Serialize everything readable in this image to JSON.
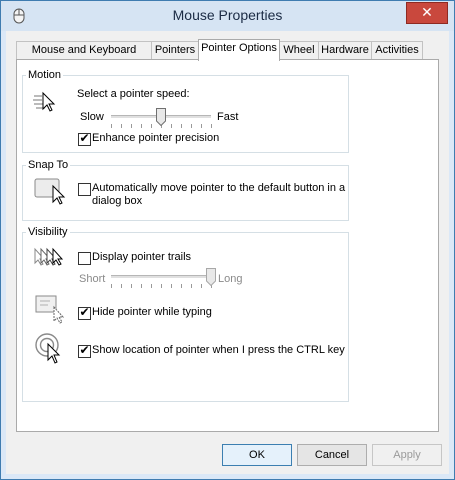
{
  "window": {
    "title": "Mouse Properties",
    "close_glyph": "✕"
  },
  "tabs": [
    {
      "label": "Mouse and Keyboard Center",
      "active": false
    },
    {
      "label": "Pointers",
      "active": false
    },
    {
      "label": "Pointer Options",
      "active": true
    },
    {
      "label": "Wheel",
      "active": false
    },
    {
      "label": "Hardware",
      "active": false
    },
    {
      "label": "Activities",
      "active": false
    }
  ],
  "motion": {
    "group_label": "Motion",
    "prompt": "Select a pointer speed:",
    "slow_label": "Slow",
    "fast_label": "Fast",
    "speed_level": 0.5,
    "enhance_label": "Enhance pointer precision",
    "enhance_checked": true
  },
  "snap_to": {
    "group_label": "Snap To",
    "line1": "Automatically move pointer to the default button in a",
    "line2": "dialog box",
    "checked": false
  },
  "visibility": {
    "group_label": "Visibility",
    "trails_label": "Display pointer trails",
    "trails_checked": false,
    "short_label": "Short",
    "long_label": "Long",
    "trail_level": 1.0,
    "hide_label": "Hide pointer while typing",
    "hide_checked": true,
    "ctrl_label": "Show location of pointer when I press the CTRL key",
    "ctrl_checked": true
  },
  "buttons": {
    "ok": "OK",
    "cancel": "Cancel",
    "apply": "Apply"
  },
  "icons": [
    "mouse-app-icon",
    "pointer-speed-icon",
    "snap-to-icon",
    "pointer-trails-icon",
    "hide-pointer-icon",
    "ctrl-locate-icon"
  ],
  "colors": {
    "accent": "#3c7fb1",
    "close": "#c9483d",
    "frame": "#d6e4f3"
  }
}
